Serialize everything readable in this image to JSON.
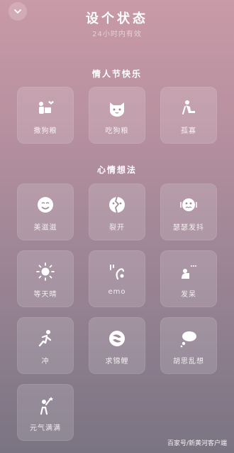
{
  "header": {
    "title": "设个状态",
    "subtitle": "24小时内有效"
  },
  "sections": [
    {
      "title": "情人节快乐",
      "items": [
        {
          "label": "撒狗粮",
          "icon": "giving-gift-icon"
        },
        {
          "label": "吃狗粮",
          "icon": "cat-face-icon"
        },
        {
          "label": "孤寡",
          "icon": "sitting-alone-icon"
        }
      ]
    },
    {
      "title": "心情想法",
      "items": [
        {
          "label": "美滋滋",
          "icon": "smile-face-icon"
        },
        {
          "label": "裂开",
          "icon": "cracked-face-icon"
        },
        {
          "label": "瑟瑟发抖",
          "icon": "shivering-face-icon"
        },
        {
          "label": "等天晴",
          "icon": "sun-icon"
        },
        {
          "label": "emo",
          "icon": "emo-icon"
        },
        {
          "label": "发呆",
          "icon": "daze-icon"
        },
        {
          "label": "冲",
          "icon": "running-icon"
        },
        {
          "label": "求锦鲤",
          "icon": "koi-icon"
        },
        {
          "label": "胡思乱想",
          "icon": "thought-bubble-icon"
        },
        {
          "label": "元气满满",
          "icon": "energetic-icon"
        }
      ]
    }
  ],
  "watermark": "百家号/新黄河客户端"
}
